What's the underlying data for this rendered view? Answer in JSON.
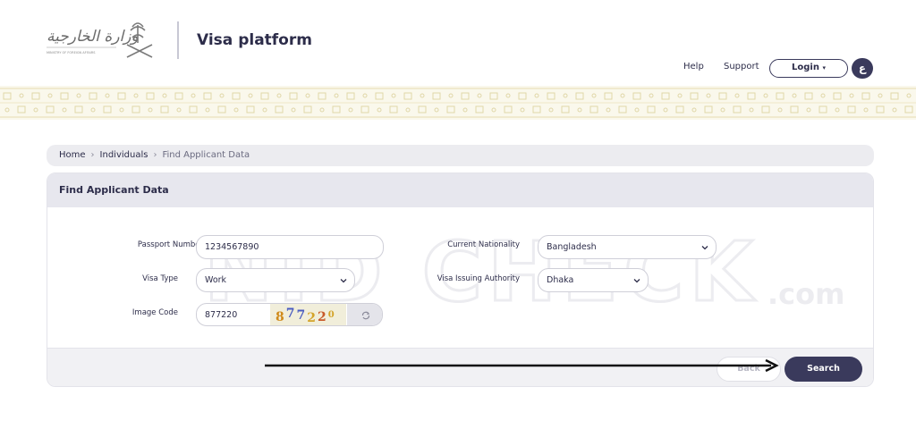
{
  "header": {
    "title": "Visa platform",
    "nav": {
      "help": "Help",
      "support": "Support",
      "login": "Login",
      "lang": "ع"
    },
    "logo_icon": "ministry-emblem-icon"
  },
  "breadcrumb": {
    "items": [
      "Home",
      "Individuals",
      "Find Applicant Data"
    ]
  },
  "card": {
    "title": "Find Applicant Data",
    "fields": {
      "passport_label": "Passport Number",
      "passport_value": "1234567890",
      "nationality_label": "Current Nationality",
      "nationality_value": "Bangladesh",
      "visa_type_label": "Visa Type",
      "visa_type_value": "Work",
      "authority_label": "Visa Issuing Authority",
      "authority_value": "Dhaka",
      "image_code_label": "Image Code",
      "image_code_value": "877220",
      "captcha_text": "877220"
    },
    "actions": {
      "back": "Back",
      "search": "Search"
    }
  },
  "watermark": {
    "text": "NID CHECK",
    "suffix": ".com"
  },
  "colors": {
    "primary": "#3a3a5c",
    "pattern": "#e8e0b8",
    "panel": "#e7e7ee"
  }
}
